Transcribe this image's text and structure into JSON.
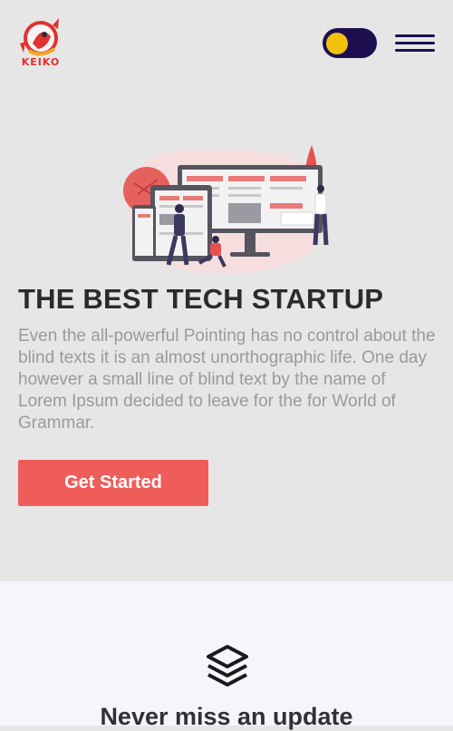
{
  "brand": {
    "name": "KEIKO"
  },
  "header": {
    "theme_toggle": {
      "state": "light",
      "knob_color": "#f2c20b",
      "track_color": "#1d0f4f"
    },
    "menu_icon": "hamburger-icon"
  },
  "hero": {
    "title": "THE BEST TECH STARTUP",
    "description": "Even the all-powerful Pointing has no control about the blind texts it is an almost unorthographic life. One day however a small line of blind text by the name of Lorem Ipsum decided to leave for the for World of Grammar.",
    "cta_label": "Get Started",
    "illustration": "tech-startup-illustration"
  },
  "features": {
    "icon": "layers-icon",
    "title": "Never miss an update"
  },
  "colors": {
    "accent": "#ef5d5a",
    "brand": "#e0322f",
    "dark": "#1d0f4f",
    "hero_bg": "#e6e6e6",
    "section_bg": "#f4f6fc"
  }
}
